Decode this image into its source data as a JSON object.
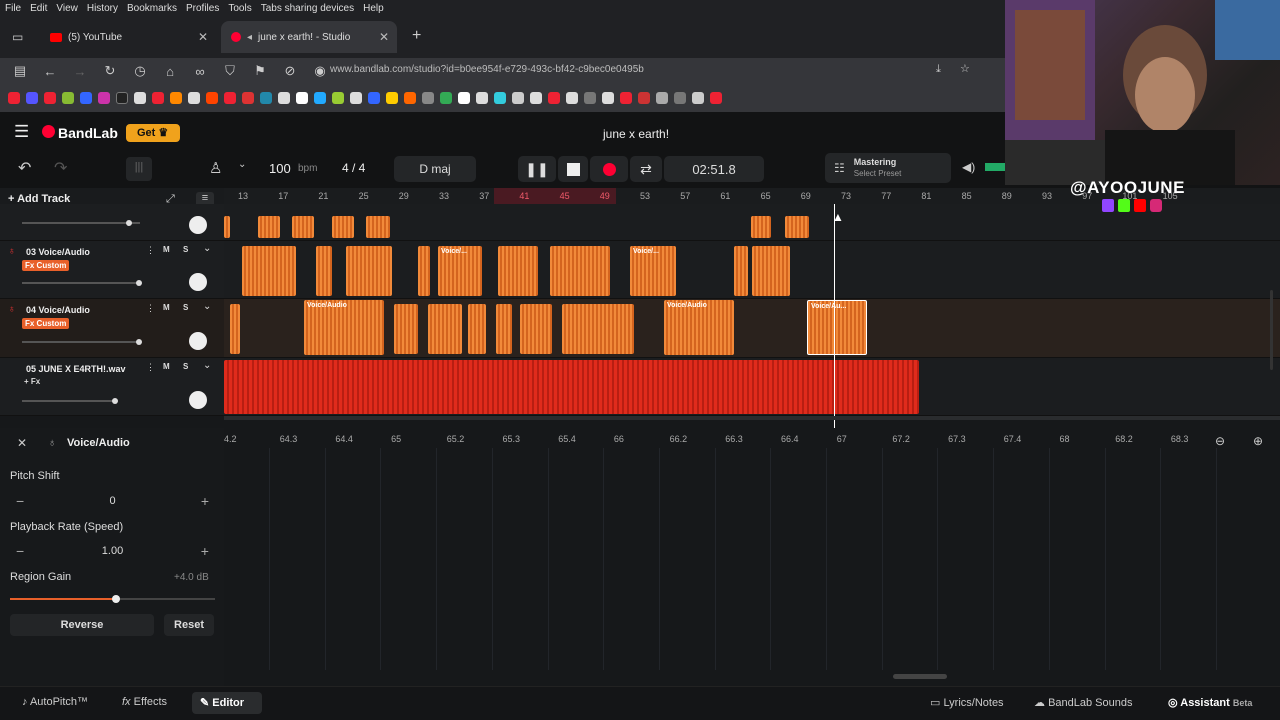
{
  "browser": {
    "menu": [
      "File",
      "Edit",
      "View",
      "History",
      "Bookmarks",
      "Profiles",
      "Tools",
      "Tabs sharing devices",
      "Help"
    ],
    "tabs": [
      {
        "label": "(5) YouTube"
      },
      {
        "label": "june x earth! - Studio"
      }
    ],
    "url": "www.bandlab.com/studio?id=b0ee954f-e729-493c-bf42-c9bec0e0495b"
  },
  "app": {
    "logo": "BandLab",
    "get_label": "Get",
    "project_title": "june x earth!",
    "tempo": "100",
    "tempo_unit": "bpm",
    "time_sig": "4 / 4",
    "key": "D maj",
    "time": "02:51.8",
    "mastering_title": "Mastering",
    "mastering_sub": "Select Preset",
    "add_track": "Add Track"
  },
  "ruler": [
    "13",
    "17",
    "21",
    "25",
    "29",
    "33",
    "37",
    "41",
    "45",
    "49",
    "53",
    "57",
    "61",
    "65",
    "69",
    "73",
    "77",
    "81",
    "85",
    "89",
    "93",
    "97",
    "101",
    "105"
  ],
  "tracks": [
    {
      "name": "03  Voice/Audio",
      "fx": "Fx Custom",
      "mute": "M",
      "solo": "S"
    },
    {
      "name": "04  Voice/Audio",
      "fx": "Fx Custom",
      "mute": "M",
      "solo": "S"
    },
    {
      "name": "05  JUNE X E4RTH!.wav",
      "fx": "+ Fx",
      "mute": "M",
      "solo": "S"
    }
  ],
  "clip_labels": {
    "voice_full": "Voice/Audio",
    "voice_short": "Voice/...",
    "voice_cut": "Voice/Au..."
  },
  "editor": {
    "title": "Voice/Audio",
    "pitch_label": "Pitch Shift",
    "pitch_value": "0",
    "rate_label": "Playback Rate (Speed)",
    "rate_value": "1.00",
    "gain_label": "Region Gain",
    "gain_value": "+4.0 dB",
    "reverse": "Reverse",
    "reset": "Reset",
    "ruler": [
      "4.2",
      "64.3",
      "64.4",
      "65",
      "65.2",
      "65.3",
      "65.4",
      "66",
      "66.2",
      "66.3",
      "66.4",
      "67",
      "67.2",
      "67.3",
      "67.4",
      "68",
      "68.2",
      "68.3"
    ]
  },
  "bottom": {
    "autopitch": "AutoPitch™",
    "effects": "Effects",
    "editor": "Editor",
    "lyrics": "Lyrics/Notes",
    "sounds": "BandLab Sounds",
    "assistant": "Assistant",
    "beta": "Beta"
  },
  "overlay": {
    "handle": "@AYOOJUNE"
  }
}
